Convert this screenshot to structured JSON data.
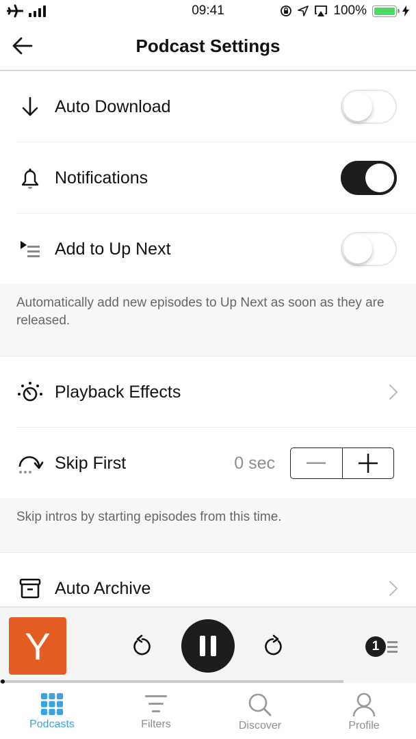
{
  "status_bar": {
    "time": "09:41",
    "battery_percent": "100%",
    "battery_level": 1.0,
    "icons": [
      "airplane-icon",
      "signal-icon",
      "rotation-lock-icon",
      "location-icon",
      "airplay-icon",
      "battery-icon",
      "charging-icon"
    ]
  },
  "nav": {
    "title": "Podcast Settings",
    "back_icon": "arrow-left-icon"
  },
  "settings": {
    "auto_download": {
      "label": "Auto Download",
      "icon": "arrow-down-icon",
      "enabled": false
    },
    "notifications": {
      "label": "Notifications",
      "icon": "bell-icon",
      "enabled": true
    },
    "add_to_up_next": {
      "label": "Add to Up Next",
      "icon": "up-next-icon",
      "enabled": false
    },
    "up_next_note": "Automatically add new episodes to Up Next as soon as they are released.",
    "playback_effects": {
      "label": "Playback Effects",
      "icon": "playback-effects-icon"
    },
    "skip_first": {
      "label": "Skip First",
      "icon": "skip-forward-arc-icon",
      "value": "0 sec",
      "decrement": "−",
      "increment": "+"
    },
    "skip_note": "Skip intros by starting episodes from this time.",
    "auto_archive": {
      "label": "Auto Archive",
      "icon": "archive-icon"
    }
  },
  "player": {
    "artwork_letter": "Y",
    "artwork_color": "#e35d22",
    "up_next_count": "1",
    "progress": 0.0
  },
  "tabs": [
    {
      "label": "Podcasts",
      "icon": "grid-icon",
      "active": true
    },
    {
      "label": "Filters",
      "icon": "filter-icon",
      "active": false
    },
    {
      "label": "Discover",
      "icon": "search-icon",
      "active": false
    },
    {
      "label": "Profile",
      "icon": "profile-icon",
      "active": false
    }
  ],
  "colors": {
    "accent": "#3aa3e3",
    "toggle_on": "#1d1d1d",
    "inactive": "#8e8e8e"
  }
}
